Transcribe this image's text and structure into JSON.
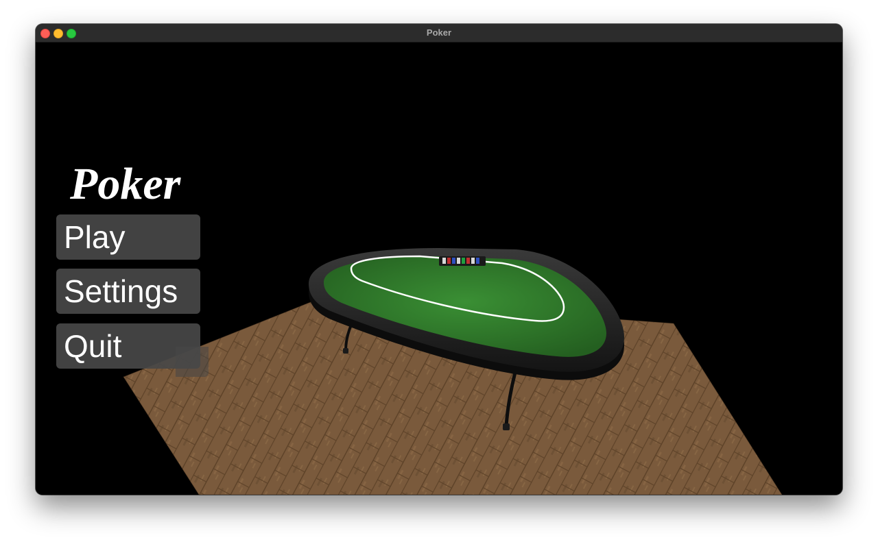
{
  "window": {
    "title": "Poker"
  },
  "menu": {
    "title": "Poker",
    "buttons": {
      "play": "Play",
      "settings": "Settings",
      "quit": "Quit"
    }
  },
  "scene": {
    "background_color": "#000000",
    "felt_color": "#2f7d2a",
    "rail_color": "#2a2a2a",
    "floor_color": "#7a5a3c",
    "betting_line_color": "#ffffff"
  },
  "colors": {
    "button_bg": "#484848",
    "button_text": "#ffffff",
    "titlebar_bg": "#2c2c2c"
  }
}
